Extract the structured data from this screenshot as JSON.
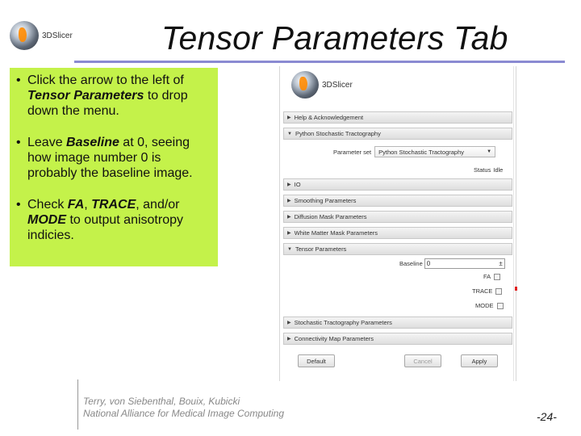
{
  "slide": {
    "logo_text": "3DSlicer",
    "title": "Tensor Parameters Tab",
    "bullets": [
      {
        "pre": "Click the arrow to the left of ",
        "em": "Tensor Parameters",
        "post": " to drop down the menu."
      },
      {
        "pre": "Leave ",
        "em": "Baseline",
        "post": " at 0, seeing how image number 0 is probably the baseline image."
      },
      {
        "pre": "Check ",
        "em": "FA",
        "mid1": ", ",
        "em2": "TRACE",
        "mid2": ", and/or ",
        "em3": "MODE",
        "post": " to output anisotropy indicies."
      }
    ],
    "footer": {
      "authors": "Terry, von Siebenthal, Bouix, Kubicki",
      "org": "National Alliance for Medical Image Computing"
    },
    "page_number": "-24-"
  },
  "app": {
    "logo_text": "3DSlicer",
    "sections": {
      "help": "Help & Acknowledgement",
      "python": "Python Stochastic Tractography",
      "io": "IO",
      "smoothing": "Smoothing Parameters",
      "diffusion_mask": "Diffusion Mask Parameters",
      "white_matter_mask": "White Matter Mask Parameters",
      "tensor": "Tensor Parameters",
      "stochastic": "Stochastic Tractography Parameters",
      "connectivity": "Connectivity Map Parameters"
    },
    "arrows": {
      "collapsed": "▶",
      "expanded": "▼"
    },
    "parameter_set": {
      "label": "Parameter set",
      "value": "Python Stochastic Tractography"
    },
    "status": {
      "label": "Status",
      "value": "Idle"
    },
    "baseline": {
      "label": "Baseline",
      "value": "0"
    },
    "checkboxes": {
      "fa": "FA",
      "trace": "TRACE",
      "mode": "MODE"
    },
    "buttons": {
      "reset": "Default",
      "cancel": "Cancel",
      "apply": "Apply"
    }
  }
}
